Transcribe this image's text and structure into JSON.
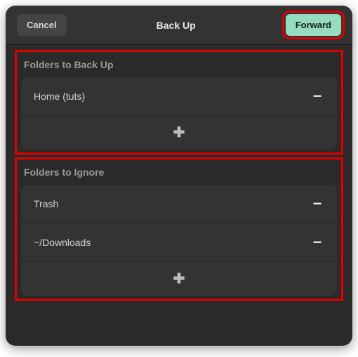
{
  "header": {
    "cancel_label": "Cancel",
    "title": "Back Up",
    "forward_label": "Forward"
  },
  "sections": {
    "backup": {
      "title": "Folders to Back Up",
      "items": [
        {
          "label": "Home (tuts)"
        }
      ]
    },
    "ignore": {
      "title": "Folders to Ignore",
      "items": [
        {
          "label": "Trash"
        },
        {
          "label": "~/Downloads"
        }
      ]
    }
  },
  "icons": {
    "minus": "−",
    "plus": "✚"
  },
  "colors": {
    "highlight": "#e00000",
    "forward_bg": "#95dcc0"
  }
}
